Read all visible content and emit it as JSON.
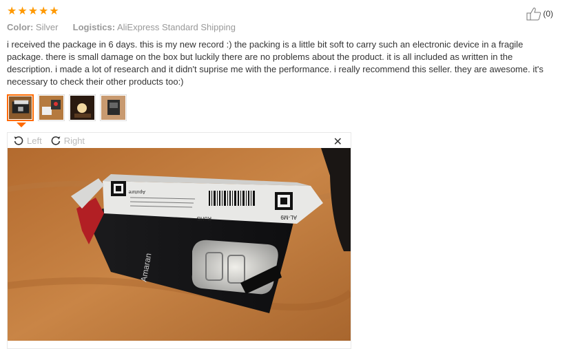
{
  "rating": {
    "stars": 5,
    "star_glyph": "★",
    "color": "#ff9900"
  },
  "helpful": {
    "count": "(0)"
  },
  "meta": {
    "color_label": "Color:",
    "color_value": "Silver",
    "logistics_label": "Logistics:",
    "logistics_value": "AliExpress Standard Shipping"
  },
  "review_text": "i received the package in 6 days. this is my new record :) the packing is a little bit soft to carry such an electronic device in a fragile package. there is small damage on the box but luckily there are no problems about the product. it is all included as written in the description. i made a lot of research and it didn't suprise me with the performance. i really recommend this seller. they are awesome. it's necessary to check their other products too:)",
  "thumbnails": [
    {
      "name": "photo-1",
      "active": true
    },
    {
      "name": "photo-2",
      "active": false
    },
    {
      "name": "photo-3",
      "active": false
    },
    {
      "name": "photo-4",
      "active": false
    }
  ],
  "viewer": {
    "rotate_left": "Left",
    "rotate_right": "Right",
    "close_glyph": "✕"
  },
  "photo_text": {
    "brand": "Amaran",
    "model": "AL-M9",
    "rohs": "RoHS",
    "maker": "Aputure"
  },
  "accent_color": "#ff6a00"
}
